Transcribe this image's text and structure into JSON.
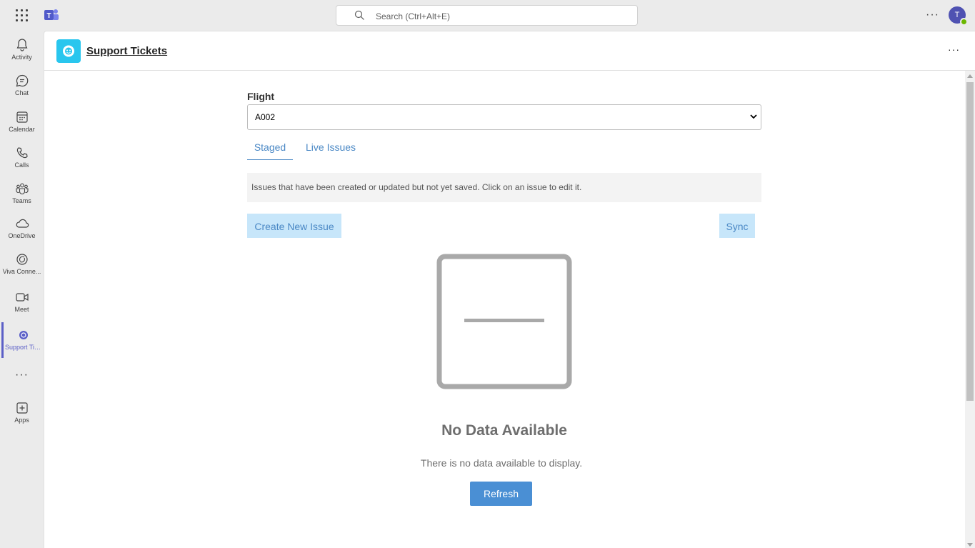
{
  "topbar": {
    "search_placeholder": "Search (Ctrl+Alt+E)",
    "avatar_initial": "T",
    "more_label": "···"
  },
  "rail": {
    "items": [
      {
        "label": "Activity",
        "icon": "bell-icon"
      },
      {
        "label": "Chat",
        "icon": "chat-icon"
      },
      {
        "label": "Calendar",
        "icon": "calendar-icon"
      },
      {
        "label": "Calls",
        "icon": "phone-icon"
      },
      {
        "label": "Teams",
        "icon": "teams-icon"
      },
      {
        "label": "OneDrive",
        "icon": "cloud-icon"
      },
      {
        "label": "Viva Conne...",
        "icon": "viva-icon"
      },
      {
        "label": "Meet",
        "icon": "video-icon"
      },
      {
        "label": "Support Tic...",
        "icon": "support-app-icon"
      },
      {
        "label": "Apps",
        "icon": "add-app-icon"
      }
    ],
    "more_label": "···",
    "active_color": "#5b5fc7"
  },
  "app": {
    "title": "Support Tickets",
    "more_label": "···",
    "accent": "#29c6ee"
  },
  "form": {
    "flight_label": "Flight",
    "flight_value": "A002",
    "tabs": [
      "Staged",
      "Live Issues"
    ],
    "info_text": "Issues that have been created or updated but not yet saved. Click on an issue to edit it.",
    "create_label": "Create New Issue",
    "sync_label": "Sync"
  },
  "empty_state": {
    "title": "No Data Available",
    "subtitle": "There is no data available to display.",
    "refresh_label": "Refresh"
  }
}
